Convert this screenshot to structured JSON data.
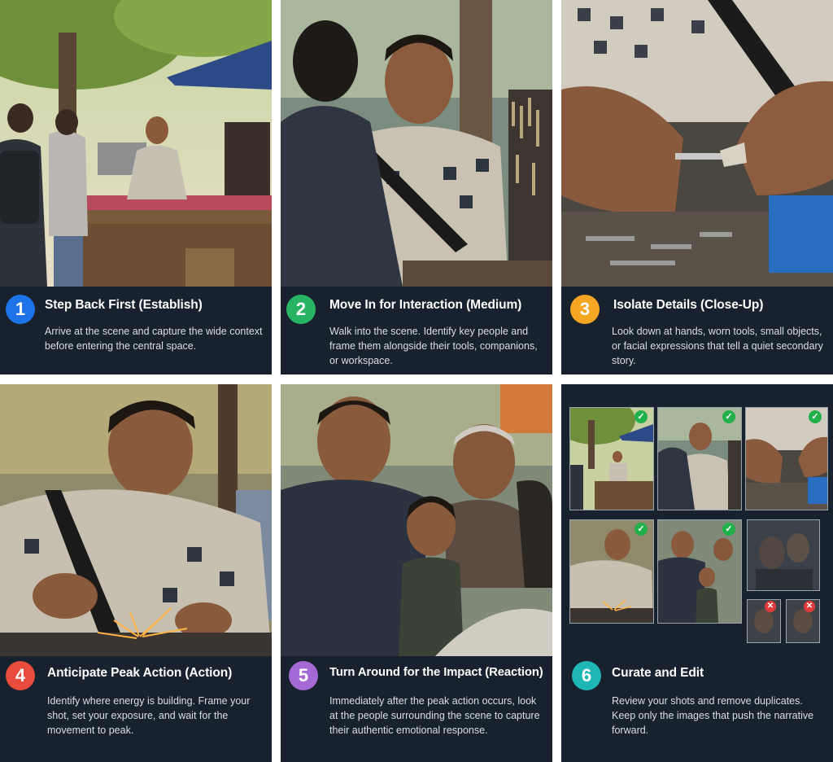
{
  "colors": {
    "caption_bg": "#17222e",
    "step1": "#1e73e8",
    "step2": "#28b463",
    "step3": "#f5a623",
    "step4": "#e74c3c",
    "step5": "#a569d6",
    "step6": "#1fb6b6",
    "approved": "#22b04b",
    "rejected": "#e23b3b"
  },
  "steps": [
    {
      "number": "1",
      "title": "Step Back First (Establish)",
      "body": "Arrive at the scene and capture the wide context before entering the central space.",
      "photo": "wide-market-scene"
    },
    {
      "number": "2",
      "title": "Move In for Interaction (Medium)",
      "body": "Walk into the scene. Identify key people and frame them alongside their tools, companions, or workspace.",
      "photo": "vendor-medium-shot"
    },
    {
      "number": "3",
      "title": "Isolate Details (Close-Up)",
      "body": "Look down at hands, worn tools, small objects, or facial expressions that tell a quiet secondary story.",
      "photo": "hands-keys-closeup"
    },
    {
      "number": "4",
      "title": "Anticipate Peak Action (Action)",
      "body": "Identify where energy is building. Frame your shot, set your exposure, and wait for the movement to peak.",
      "photo": "grinding-sparks"
    },
    {
      "number": "5",
      "title": "Turn Around for the Impact (Reaction)",
      "body": "Immediately after the peak action occurs, look at the people surrounding the scene to capture their authentic emotional response.",
      "photo": "smiling-onlookers"
    },
    {
      "number": "6",
      "title": "Curate and Edit",
      "body": "Review your shots and remove duplicates. Keep only the images that push the narrative forward.",
      "photo": "contact-sheet"
    }
  ],
  "contact_sheet": {
    "kept": [
      "establish",
      "medium",
      "close-up",
      "action",
      "reaction"
    ],
    "rejected": [
      "blurry-duplicate-1",
      "blurry-duplicate-2"
    ],
    "kept_icon": "check-icon",
    "rejected_icon": "x-icon"
  }
}
